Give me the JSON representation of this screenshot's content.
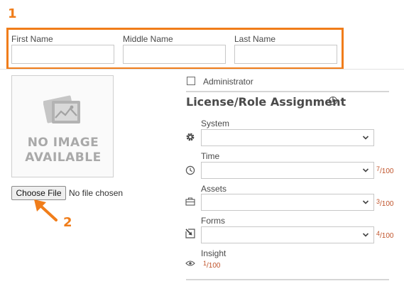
{
  "annotations": {
    "callout_1": "1",
    "callout_2": "2",
    "accent_color": "#f07d1a"
  },
  "name_fields": [
    {
      "label": "First Name",
      "value": ""
    },
    {
      "label": "Middle Name",
      "value": ""
    },
    {
      "label": "Last Name",
      "value": ""
    }
  ],
  "photo": {
    "placeholder_line1": "NO IMAGE",
    "placeholder_line2": "AVAILABLE",
    "choose_file_label": "Choose File",
    "file_status": "No file chosen"
  },
  "administrator": {
    "label": "Administrator",
    "checked": false
  },
  "license": {
    "title": "License/Role Assignment",
    "info_icon": "info-icon",
    "roles": [
      {
        "label": "System",
        "icon": "gear-icon",
        "selected": "",
        "used": null,
        "total": null
      },
      {
        "label": "Time",
        "icon": "clock-icon",
        "selected": "",
        "used": "7",
        "total": "100"
      },
      {
        "label": "Assets",
        "icon": "briefcase-icon",
        "selected": "",
        "used": "3",
        "total": "100"
      },
      {
        "label": "Forms",
        "icon": "form-arrow-icon",
        "selected": "",
        "used": "4",
        "total": "100"
      },
      {
        "label": "Insight",
        "icon": "eye-icon",
        "selected": null,
        "used": "1",
        "total": "100"
      }
    ],
    "count_color": "#c0532a"
  }
}
